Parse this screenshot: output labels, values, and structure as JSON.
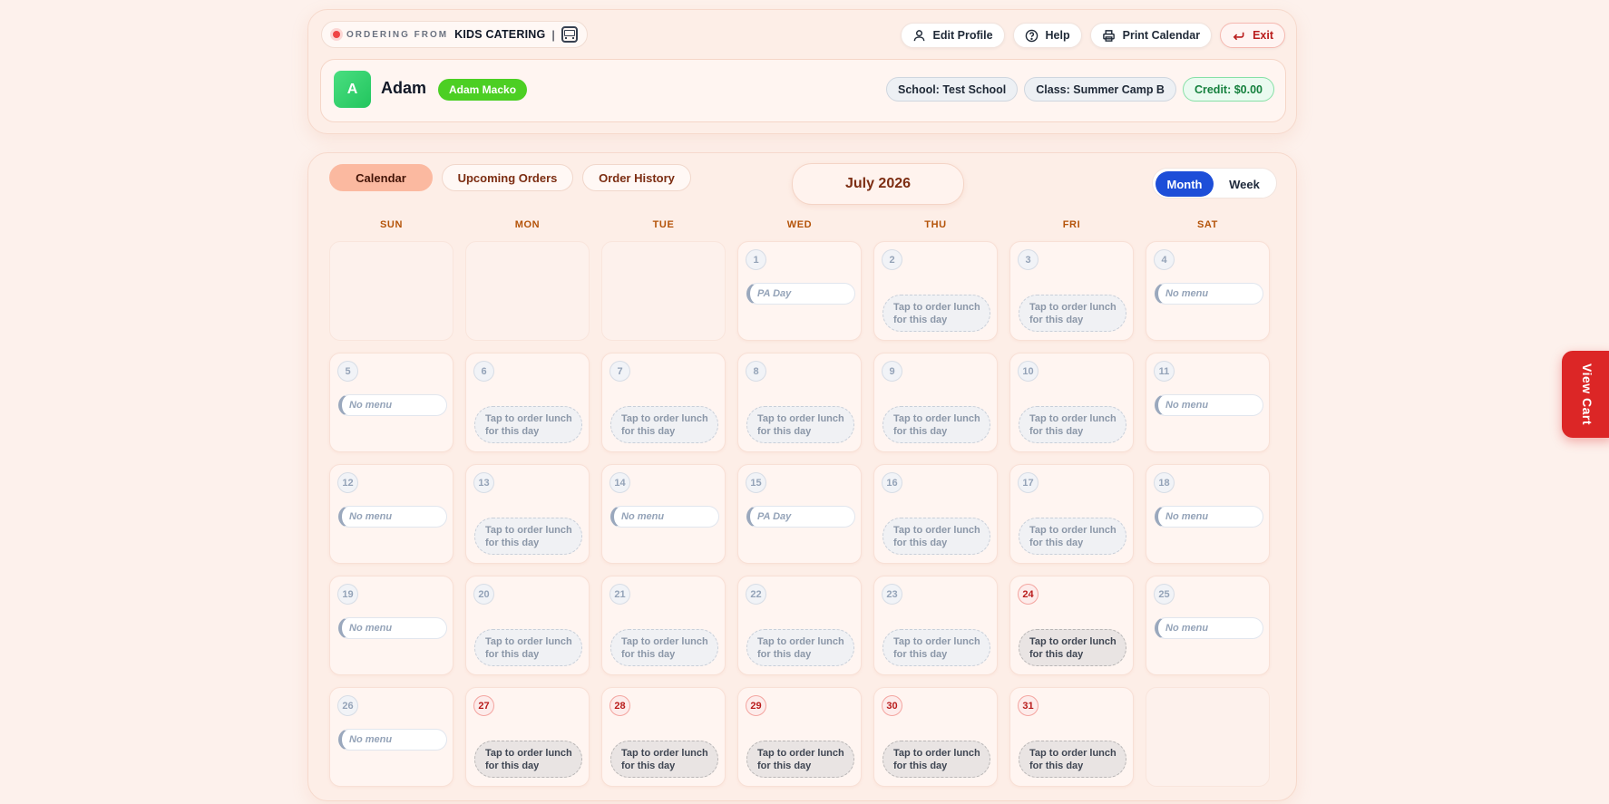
{
  "brand": {
    "prefix": "ORDERING FROM",
    "name": "KIDS CATERING",
    "separator": "|",
    "icon": "bus-icon"
  },
  "actions": {
    "edit_profile": "Edit Profile",
    "help": "Help",
    "print_calendar": "Print Calendar",
    "exit": "Exit"
  },
  "user": {
    "initial": "A",
    "name": "Adam",
    "badge": "Adam Macko",
    "school": "School: Test School",
    "class": "Class: Summer Camp B",
    "credit": "Credit: $0.00"
  },
  "tabs": [
    "Calendar",
    "Upcoming Orders",
    "Order History"
  ],
  "active_tab": "Calendar",
  "month_title": "July 2026",
  "view_toggle": {
    "month": "Month",
    "week": "Week",
    "active": "Month"
  },
  "weekdays": [
    "SUN",
    "MON",
    "TUE",
    "WED",
    "THU",
    "FRI",
    "SAT"
  ],
  "order_label": "Tap to order lunch for this day",
  "no_menu_label": "No menu",
  "pa_day_label": "PA Day",
  "days": [
    {
      "day": "",
      "type": "empty"
    },
    {
      "day": "",
      "type": "empty"
    },
    {
      "day": "",
      "type": "empty"
    },
    {
      "day": "1",
      "type": "pa"
    },
    {
      "day": "2",
      "type": "order"
    },
    {
      "day": "3",
      "type": "order"
    },
    {
      "day": "4",
      "type": "nomenu"
    },
    {
      "day": "5",
      "type": "nomenu"
    },
    {
      "day": "6",
      "type": "order"
    },
    {
      "day": "7",
      "type": "order"
    },
    {
      "day": "8",
      "type": "order"
    },
    {
      "day": "9",
      "type": "order"
    },
    {
      "day": "10",
      "type": "order"
    },
    {
      "day": "11",
      "type": "nomenu"
    },
    {
      "day": "12",
      "type": "nomenu"
    },
    {
      "day": "13",
      "type": "order"
    },
    {
      "day": "14",
      "type": "nomenu"
    },
    {
      "day": "15",
      "type": "pa"
    },
    {
      "day": "16",
      "type": "order"
    },
    {
      "day": "17",
      "type": "order"
    },
    {
      "day": "18",
      "type": "nomenu"
    },
    {
      "day": "19",
      "type": "nomenu"
    },
    {
      "day": "20",
      "type": "order"
    },
    {
      "day": "21",
      "type": "order"
    },
    {
      "day": "22",
      "type": "order"
    },
    {
      "day": "23",
      "type": "order"
    },
    {
      "day": "24",
      "type": "order",
      "highlight": true
    },
    {
      "day": "25",
      "type": "nomenu"
    },
    {
      "day": "26",
      "type": "nomenu"
    },
    {
      "day": "27",
      "type": "order",
      "highlight": true
    },
    {
      "day": "28",
      "type": "order",
      "highlight": true
    },
    {
      "day": "29",
      "type": "order",
      "highlight": true
    },
    {
      "day": "30",
      "type": "order",
      "highlight": true
    },
    {
      "day": "31",
      "type": "order",
      "highlight": true
    },
    {
      "day": "",
      "type": "empty"
    }
  ],
  "view_cart": "View Cart",
  "colors": {
    "accent_blue": "#1d4ed8",
    "active_tab": "#fbb9a0",
    "success_green": "#4ccf23",
    "danger_red": "#dc2626"
  }
}
